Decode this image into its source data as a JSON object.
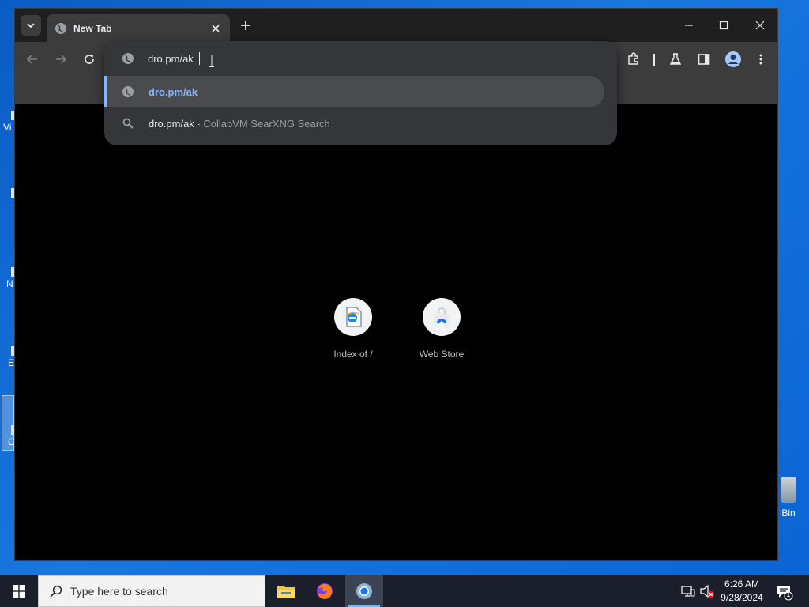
{
  "browser": {
    "tab_title": "New Tab",
    "omnibox": {
      "value": "dro.pm/ak",
      "suggestions": [
        {
          "text": "dro.pm/ak",
          "suffix": "",
          "icon": "globe-icon",
          "selected": true
        },
        {
          "text": "dro.pm/ak",
          "suffix": " - CollabVM SearXNG Search",
          "icon": "search-icon",
          "selected": false
        }
      ]
    },
    "shortcuts": [
      {
        "label": "Index of /",
        "icon": "ie-document-icon"
      },
      {
        "label": "Web Store",
        "icon": "web-store-icon"
      }
    ]
  },
  "desktop": {
    "fragments": [
      "Vi",
      "N",
      "E",
      "C"
    ],
    "recycle_bin_label": "Bin"
  },
  "taskbar": {
    "search_placeholder": "Type here to search",
    "time": "6:26 AM",
    "date": "9/28/2024",
    "notification_count": "1"
  },
  "colors": {
    "accent": "#8ab4f8",
    "omnibox_bg": "#35363a",
    "toolbar_bg": "#3c3c3c",
    "desktop_blue": "#0b5cc4"
  }
}
